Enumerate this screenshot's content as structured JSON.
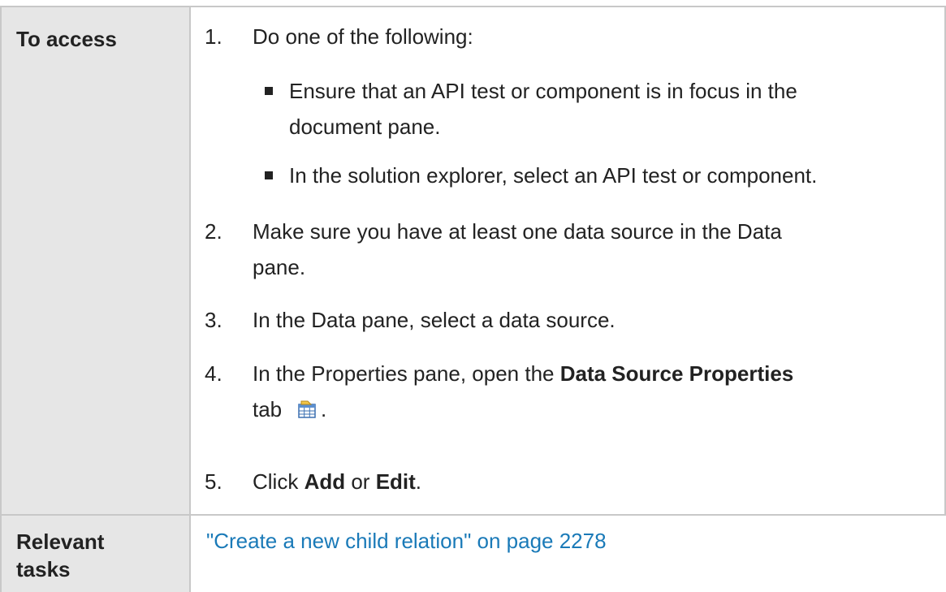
{
  "rows": {
    "access": {
      "label": "To access",
      "steps": [
        {
          "number": "1.",
          "text": "Do one of the following:"
        },
        {
          "number": "2.",
          "line1": "Make sure you have at least one data source in the Data",
          "line2": "pane."
        },
        {
          "number": "3.",
          "text": "In the Data pane, select a data source."
        },
        {
          "number": "4.",
          "line1_pre": "In the Properties pane, open the ",
          "line1_bold": "Data Source Properties",
          "line2": "tab",
          "line2_post": "."
        },
        {
          "number": "5.",
          "pre": "Click ",
          "bold1": "Add",
          "mid": " or ",
          "bold2": "Edit",
          "post": "."
        }
      ],
      "bullets": [
        {
          "line1": "Ensure that an API test or component is in focus in the",
          "line2": "document pane."
        },
        {
          "text": "In the solution explorer, select an API test or component."
        }
      ],
      "tab_icon": "data-source-properties-icon"
    },
    "tasks": {
      "label_line1": "Relevant",
      "label_line2": "tasks",
      "link_text": "\"Create a new child relation\" on page 2278",
      "link_color": "#1a7ab8"
    }
  },
  "colors": {
    "header_bg": "#e6e6e6",
    "border": "#c8c8c8",
    "text": "#222222"
  }
}
